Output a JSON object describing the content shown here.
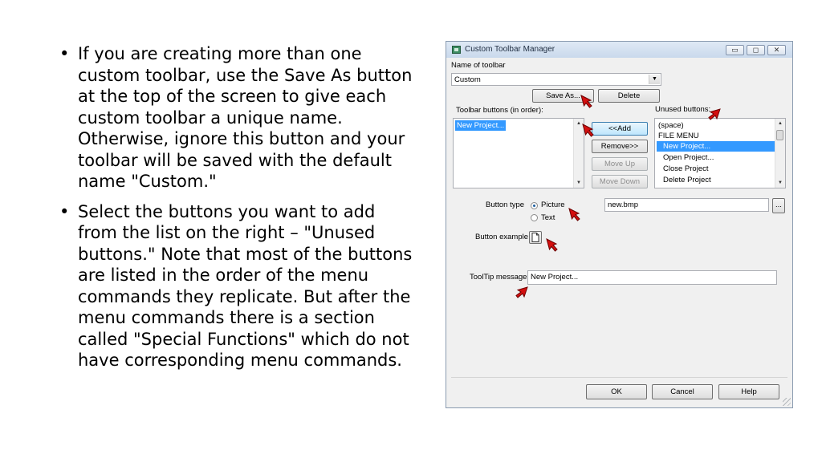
{
  "slide": {
    "bullets": [
      {
        "bullet": "•",
        "text": "If you are creating more than one custom toolbar, use the Save As button at the top of the screen to give each custom toolbar a unique name. Otherwise, ignore this button and your toolbar will be saved with the default name \"Custom.\""
      },
      {
        "bullet": "•",
        "text": "Select the buttons you want to add from the list on the right – \"Unused buttons.\" Note that most of the buttons are listed in the order of the menu commands they replicate. But after the menu commands there is a section called \"Special Functions\" which do not have corresponding menu commands."
      }
    ]
  },
  "dialog": {
    "title": "Custom Toolbar Manager",
    "window_buttons": {
      "minimize": "▭",
      "maximize": "◻",
      "close": "✕"
    },
    "name_label": "Name of toolbar",
    "name_value": "Custom",
    "save_as_label": "Save As...",
    "delete_label": "Delete",
    "toolbar_buttons_label": "Toolbar buttons (in order):",
    "toolbar_buttons": [
      "New Project..."
    ],
    "unused_buttons_label": "Unused buttons:",
    "unused_buttons": [
      "(space)",
      "FILE MENU",
      "New Project...",
      "Open Project...",
      "Close Project",
      "Delete Project"
    ],
    "add_label": "<<Add",
    "remove_label": "Remove>>",
    "move_up_label": "Move Up",
    "move_down_label": "Move Down",
    "button_type_label": "Button type",
    "type_picture": "Picture",
    "type_text": "Text",
    "picture_file": "new.bmp",
    "browse_label": "...",
    "example_label": "Button example",
    "tooltip_label": "ToolTip message:",
    "tooltip_value": "New Project...",
    "ok_label": "OK",
    "cancel_label": "Cancel",
    "help_label": "Help"
  },
  "colors": {
    "arrow": "#d40f0f",
    "selection": "#3399ff"
  }
}
